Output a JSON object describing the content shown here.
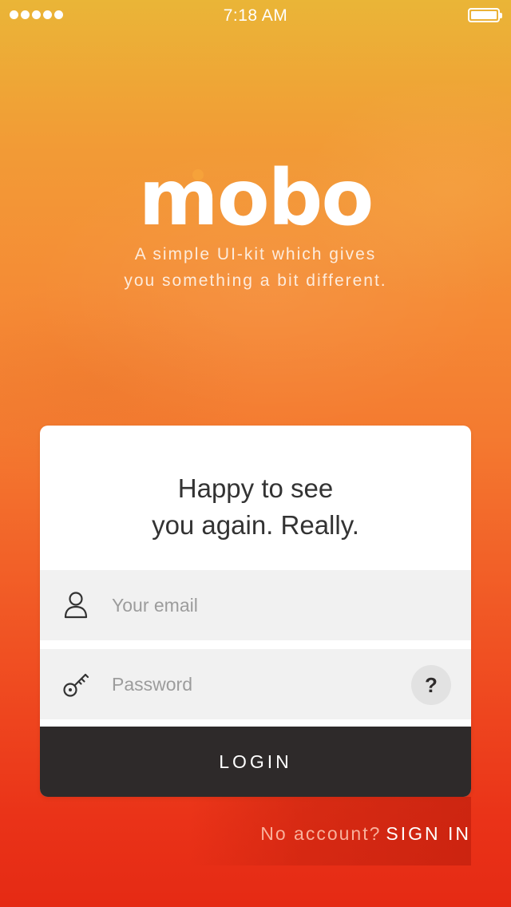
{
  "status_bar": {
    "time": "7:18 AM",
    "signal_dots": 5,
    "battery_level": 1.0
  },
  "brand": {
    "logo_text": "mobo",
    "tagline_line1": "A simple UI-kit which gives",
    "tagline_line2": "you something a bit different."
  },
  "login_card": {
    "heading_line1": "Happy to see",
    "heading_line2": "you again. Really.",
    "email_placeholder": "Your email",
    "email_icon": "user-icon",
    "password_placeholder": "Password",
    "password_icon": "key-icon",
    "help_label": "?",
    "login_label": "LOGIN"
  },
  "footer": {
    "prompt": "No account?",
    "signin_label": "SIGN IN"
  },
  "colors": {
    "gradient_top": "#eab537",
    "gradient_bottom": "#e52a14",
    "card_bg": "#ffffff",
    "field_bg": "#f1f1f1",
    "button_bg": "#2e2a2a",
    "text_dark": "#333333"
  }
}
